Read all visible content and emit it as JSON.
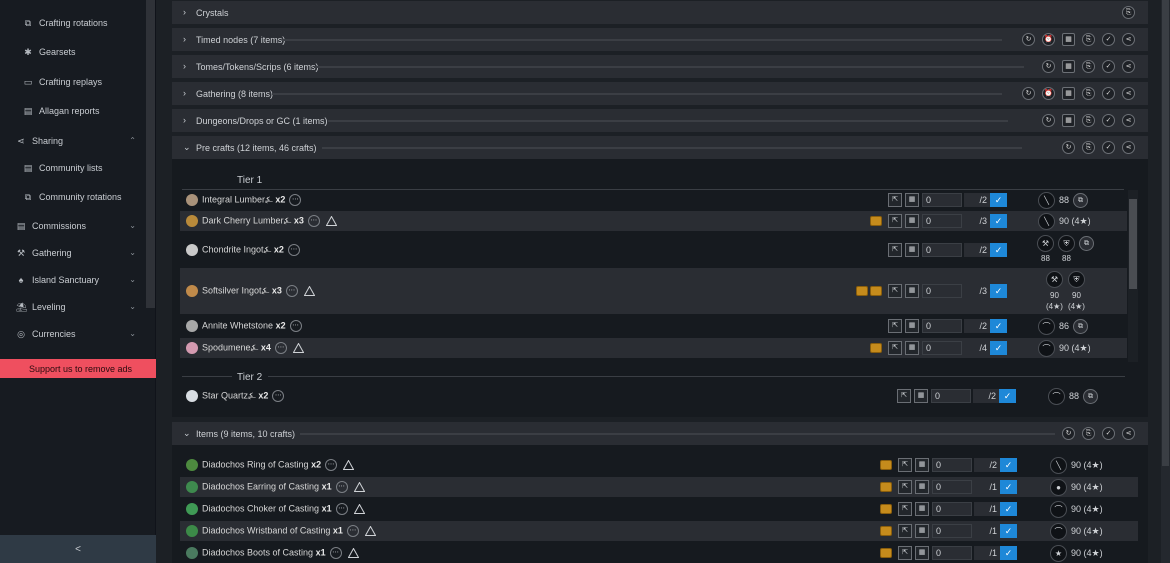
{
  "sidebar": {
    "items": [
      {
        "label": "Crafting rotations",
        "icon": "rotation-icon"
      },
      {
        "label": "Gearsets",
        "icon": "gearset-icon"
      },
      {
        "label": "Crafting replays",
        "icon": "replay-icon"
      },
      {
        "label": "Allagan reports",
        "icon": "reports-icon"
      },
      {
        "label": "Sharing",
        "icon": "share-icon"
      },
      {
        "label": "Community lists",
        "icon": "list-icon"
      },
      {
        "label": "Community rotations",
        "icon": "rotation-icon"
      },
      {
        "label": "Commissions",
        "icon": "commission-icon"
      },
      {
        "label": "Gathering",
        "icon": "gathering-icon"
      },
      {
        "label": "Island Sanctuary",
        "icon": "island-icon"
      },
      {
        "label": "Leveling",
        "icon": "leveling-icon"
      },
      {
        "label": "Currencies",
        "icon": "currency-icon"
      }
    ],
    "ads": "Support us to remove ads",
    "collapse": "<"
  },
  "panels": {
    "crystals": "Crystals",
    "timed": "Timed nodes (7 items)",
    "tomes": "Tomes/Tokens/Scrips (6 items)",
    "gathering": "Gathering (8 items)",
    "dungeons": "Dungeons/Drops or GC (1 items)",
    "precrafts": "Pre crafts  (12 items, 46 crafts)",
    "items": "Items  (9 items, 10 crafts)"
  },
  "tiers": {
    "t1": "Tier 1",
    "t2": "Tier 2"
  },
  "precrafts": [
    {
      "name": "Integral Lumber",
      "qty": "x2",
      "value": "0",
      "den": "/2",
      "src": "88",
      "color": "#a9927a"
    },
    {
      "name": "Dark Cherry Lumber",
      "qty": "x3",
      "value": "0",
      "den": "/3",
      "src": "90 (4★)",
      "color": "#b98a3a"
    },
    {
      "name": "Chondrite Ingot",
      "qty": "x2",
      "value": "0",
      "den": "/2",
      "src1": "88",
      "src2": "88",
      "color": "#c9c9c9"
    },
    {
      "name": "Softsilver Ingot",
      "qty": "x3",
      "value": "0",
      "den": "/3",
      "src1": "90",
      "src2": "90",
      "src3": "(4★)",
      "src4": "(4★)",
      "color": "#c08a4a"
    },
    {
      "name": "Annite Whetstone",
      "qty": "x2",
      "value": "0",
      "den": "/2",
      "src": "86",
      "color": "#a8a8a8"
    },
    {
      "name": "Spodumene",
      "qty": "x4",
      "value": "0",
      "den": "/4",
      "src": "90 (4★)",
      "color": "#d49ab0"
    }
  ],
  "tier2": [
    {
      "name": "Star Quartz",
      "qty": "x2",
      "value": "0",
      "den": "/2",
      "src": "88",
      "color": "#d8dde2"
    }
  ],
  "items": [
    {
      "name": "Diadochos Ring of Casting",
      "qty": "x2",
      "value": "0",
      "den": "/2",
      "src": "90 (4★)",
      "color": "#4d8a3f"
    },
    {
      "name": "Diadochos Earring of Casting",
      "qty": "x1",
      "value": "0",
      "den": "/1",
      "src": "90 (4★)",
      "color": "#3e8a4e"
    },
    {
      "name": "Diadochos Choker of Casting",
      "qty": "x1",
      "value": "0",
      "den": "/1",
      "src": "90 (4★)",
      "color": "#3f9a55"
    },
    {
      "name": "Diadochos Wristband of Casting",
      "qty": "x1",
      "value": "0",
      "den": "/1",
      "src": "90 (4★)",
      "color": "#3c8a48"
    },
    {
      "name": "Diadochos Boots of Casting",
      "qty": "x1",
      "value": "0",
      "den": "/1",
      "src": "90 (4★)",
      "color": "#4a7a5f"
    }
  ]
}
